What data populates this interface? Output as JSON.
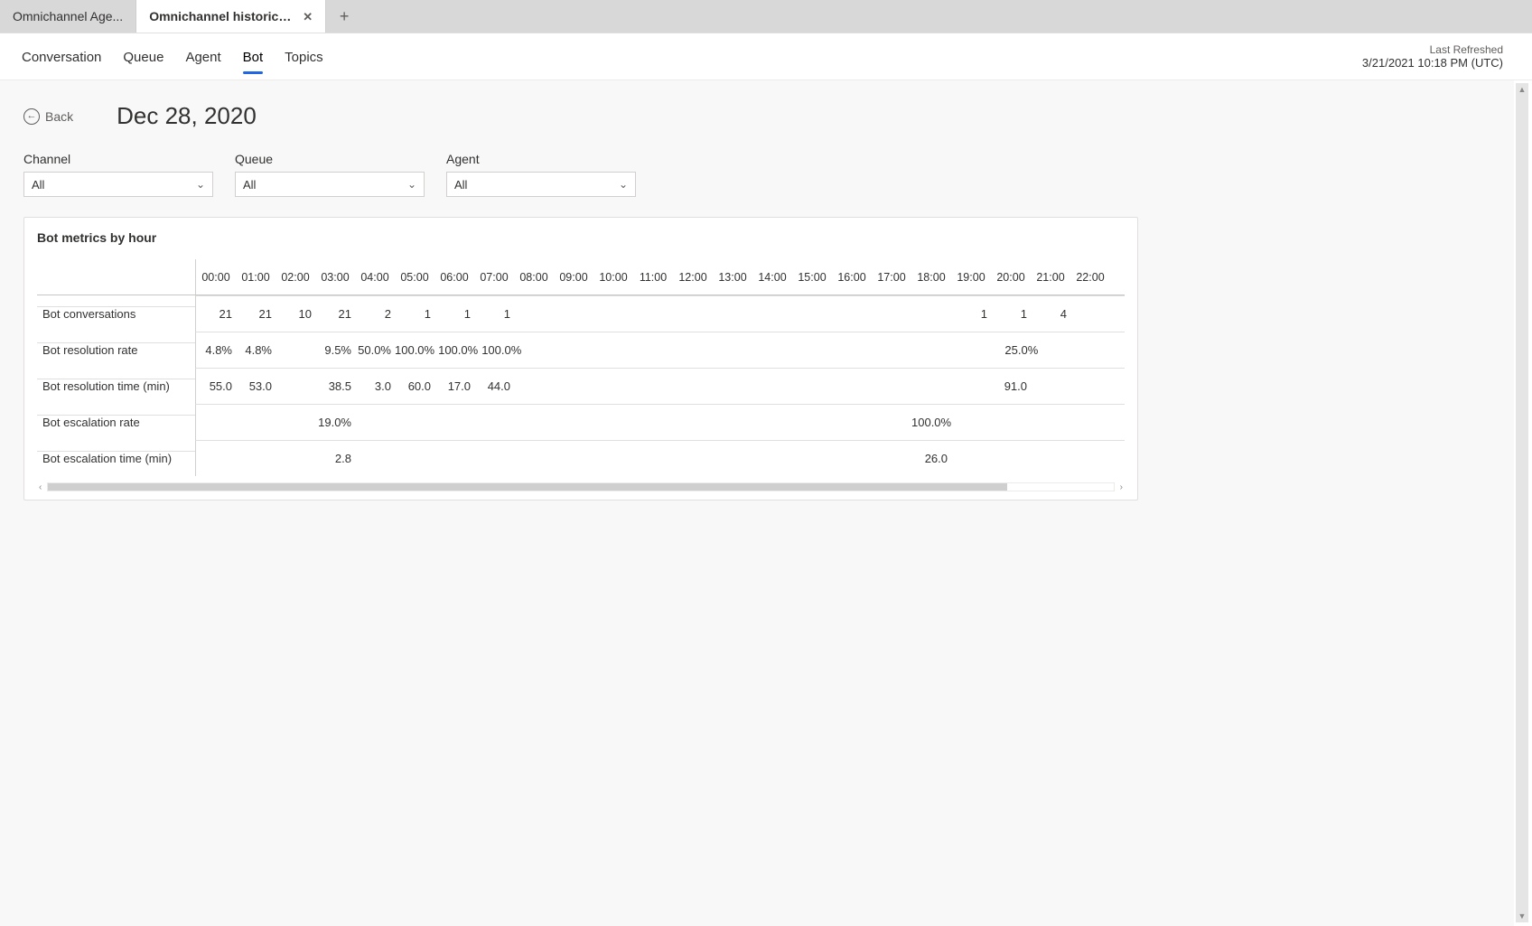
{
  "tabs": {
    "inactive": "Omnichannel Age...",
    "active": "Omnichannel historical an..."
  },
  "subnav": {
    "items": [
      "Conversation",
      "Queue",
      "Agent",
      "Bot",
      "Topics"
    ],
    "active_index": 3
  },
  "refreshed": {
    "label": "Last Refreshed",
    "value": "3/21/2021 10:18 PM (UTC)"
  },
  "page": {
    "back_label": "Back",
    "title": "Dec 28, 2020"
  },
  "filters": {
    "channel": {
      "label": "Channel",
      "value": "All"
    },
    "queue": {
      "label": "Queue",
      "value": "All"
    },
    "agent": {
      "label": "Agent",
      "value": "All"
    }
  },
  "card": {
    "title": "Bot metrics by hour"
  },
  "chart_data": {
    "type": "table",
    "title": "Bot metrics by hour",
    "categories": [
      "00:00",
      "01:00",
      "02:00",
      "03:00",
      "04:00",
      "05:00",
      "06:00",
      "07:00",
      "08:00",
      "09:00",
      "10:00",
      "11:00",
      "12:00",
      "13:00",
      "14:00",
      "15:00",
      "16:00",
      "17:00",
      "18:00",
      "19:00",
      "20:00",
      "21:00",
      "22:00"
    ],
    "series": [
      {
        "name": "Bot conversations",
        "values": [
          "21",
          "21",
          "10",
          "21",
          "2",
          "1",
          "1",
          "1",
          "",
          "",
          "",
          "",
          "",
          "",
          "",
          "",
          "",
          "",
          "",
          "1",
          "1",
          "4",
          "",
          ""
        ]
      },
      {
        "name": "Bot resolution rate",
        "values": [
          "4.8%",
          "4.8%",
          "",
          "9.5%",
          "50.0%",
          "100.0%",
          "100.0%",
          "100.0%",
          "",
          "",
          "",
          "",
          "",
          "",
          "",
          "",
          "",
          "",
          "",
          "",
          "25.0%",
          "",
          "",
          ""
        ]
      },
      {
        "name": "Bot resolution time (min)",
        "values": [
          "55.0",
          "53.0",
          "",
          "38.5",
          "3.0",
          "60.0",
          "17.0",
          "44.0",
          "",
          "",
          "",
          "",
          "",
          "",
          "",
          "",
          "",
          "",
          "",
          "",
          "91.0",
          "",
          "",
          ""
        ]
      },
      {
        "name": "Bot escalation rate",
        "values": [
          "",
          "",
          "",
          "19.0%",
          "",
          "",
          "",
          "",
          "",
          "",
          "",
          "",
          "",
          "",
          "",
          "",
          "",
          "",
          "100.0%",
          "",
          "",
          "",
          "",
          ""
        ]
      },
      {
        "name": "Bot escalation time (min)",
        "values": [
          "",
          "",
          "",
          "2.8",
          "",
          "",
          "",
          "",
          "",
          "",
          "",
          "",
          "",
          "",
          "",
          "",
          "",
          "",
          "26.0",
          "",
          "",
          "",
          "",
          ""
        ]
      }
    ]
  }
}
